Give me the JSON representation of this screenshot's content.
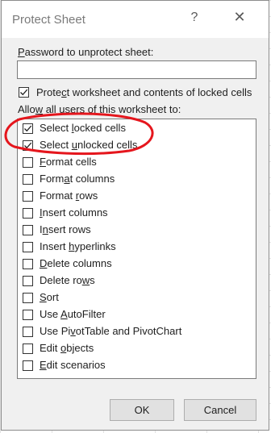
{
  "dialog": {
    "title": "Protect Sheet",
    "help_glyph": "?",
    "close_glyph": "✕"
  },
  "password": {
    "label_pre": "",
    "label_u": "P",
    "label_post": "assword to unprotect sheet:",
    "value": ""
  },
  "protect_contents": {
    "checked": true,
    "label_pre": "Prote",
    "label_u": "c",
    "label_post": "t worksheet and contents of locked cells"
  },
  "allow_label": {
    "pre": "Allo",
    "u": "w",
    "post": " all users of this worksheet to:"
  },
  "permissions": [
    {
      "pre": "Select ",
      "u": "l",
      "post": "ocked cells",
      "checked": true
    },
    {
      "pre": "Select ",
      "u": "u",
      "post": "nlocked cells",
      "checked": true
    },
    {
      "pre": "",
      "u": "F",
      "post": "ormat cells",
      "checked": false
    },
    {
      "pre": "Form",
      "u": "a",
      "post": "t columns",
      "checked": false
    },
    {
      "pre": "Format ",
      "u": "r",
      "post": "ows",
      "checked": false
    },
    {
      "pre": "",
      "u": "I",
      "post": "nsert columns",
      "checked": false
    },
    {
      "pre": "I",
      "u": "n",
      "post": "sert rows",
      "checked": false
    },
    {
      "pre": "Insert ",
      "u": "h",
      "post": "yperlinks",
      "checked": false
    },
    {
      "pre": "",
      "u": "D",
      "post": "elete columns",
      "checked": false
    },
    {
      "pre": "Delete ro",
      "u": "w",
      "post": "s",
      "checked": false
    },
    {
      "pre": "",
      "u": "S",
      "post": "ort",
      "checked": false
    },
    {
      "pre": "Use ",
      "u": "A",
      "post": "utoFilter",
      "checked": false
    },
    {
      "pre": "Use Pi",
      "u": "v",
      "post": "otTable and PivotChart",
      "checked": false
    },
    {
      "pre": "Edit ",
      "u": "o",
      "post": "bjects",
      "checked": false
    },
    {
      "pre": "",
      "u": "E",
      "post": "dit scenarios",
      "checked": false
    }
  ],
  "buttons": {
    "ok": "OK",
    "cancel": "Cancel"
  },
  "annotation": {
    "color": "#e5161d"
  }
}
